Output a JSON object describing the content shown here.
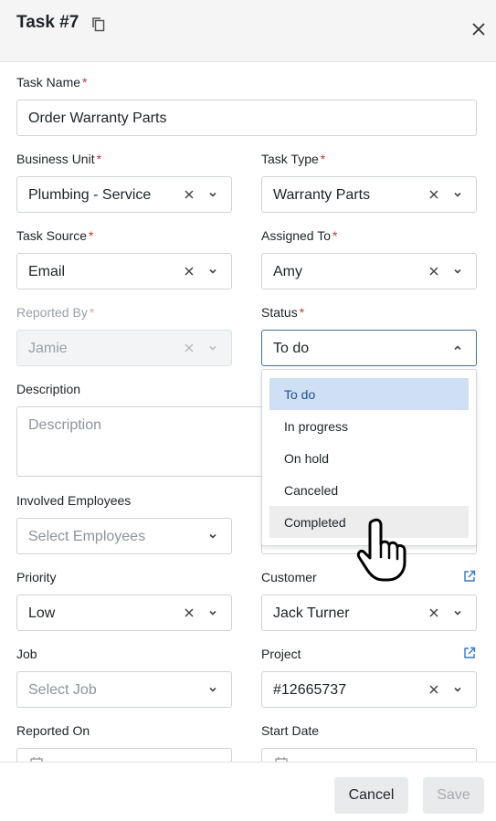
{
  "header": {
    "title": "Task #7"
  },
  "fields": {
    "task_name": {
      "label": "Task Name",
      "value": "Order Warranty Parts"
    },
    "business_unit": {
      "label": "Business Unit",
      "value": "Plumbing - Service"
    },
    "task_type": {
      "label": "Task Type",
      "value": "Warranty Parts"
    },
    "task_source": {
      "label": "Task Source",
      "value": "Email"
    },
    "assigned_to": {
      "label": "Assigned To",
      "value": "Amy"
    },
    "reported_by": {
      "label": "Reported By",
      "value": "Jamie"
    },
    "status": {
      "label": "Status",
      "value": "To do"
    },
    "description": {
      "label": "Description",
      "placeholder": "Description"
    },
    "involved_employees": {
      "label": "Involved Employees",
      "placeholder": "Select Employees"
    },
    "priority": {
      "label": "Priority",
      "value": "Low"
    },
    "customer": {
      "label": "Customer",
      "value": "Jack Turner"
    },
    "job": {
      "label": "Job",
      "placeholder": "Select Job"
    },
    "project": {
      "label": "Project",
      "value": "#12665737"
    },
    "reported_on": {
      "label": "Reported On"
    },
    "start_date": {
      "label": "Start Date"
    }
  },
  "required_marker": "*",
  "status_options": [
    "To do",
    "In progress",
    "On hold",
    "Canceled",
    "Completed"
  ],
  "status_selected": "To do",
  "status_hovered": "Completed",
  "footer": {
    "cancel_label": "Cancel",
    "save_label": "Save"
  },
  "colors": {
    "accent": "#3b6fb6",
    "required": "#c0392b",
    "selected_option": "#cfe0f5"
  },
  "icons": [
    "copy-icon",
    "close-icon",
    "clear-icon",
    "chevron-down-icon",
    "chevron-up-icon",
    "external-link-icon",
    "calendar-icon",
    "hand-pointer-cursor"
  ]
}
